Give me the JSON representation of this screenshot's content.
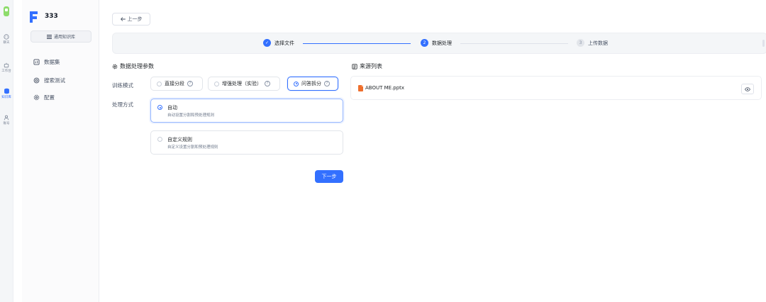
{
  "rail": {
    "items": [
      {
        "label": "聊天"
      },
      {
        "label": "工作台"
      },
      {
        "label": "知识库"
      },
      {
        "label": "账号"
      }
    ]
  },
  "sidebar": {
    "kb_name": "333",
    "kb_type": "通用知识库",
    "items": [
      {
        "label": "数据集"
      },
      {
        "label": "搜索测试"
      },
      {
        "label": "配置"
      }
    ]
  },
  "header": {
    "back_label": "上一步"
  },
  "steps": [
    {
      "index": "✓",
      "label": "选择文件",
      "status": "done"
    },
    {
      "index": "2",
      "label": "数据处理",
      "status": "active"
    },
    {
      "index": "3",
      "label": "上传数据",
      "status": "pending"
    }
  ],
  "params": {
    "title": "数据处理参数",
    "train_mode_label": "训练模式",
    "train_modes": [
      {
        "label": "直接分段",
        "selected": false
      },
      {
        "label": "增强处理（实验）",
        "selected": false
      },
      {
        "label": "问答拆分",
        "selected": true
      }
    ],
    "method_label": "处理方式",
    "methods": [
      {
        "title": "自动",
        "desc": "自动设置分割和预处理规则",
        "selected": true
      },
      {
        "title": "自定义规则",
        "desc": "自定义设置分割和预处理规则",
        "selected": false
      }
    ],
    "next_label": "下一步"
  },
  "sources": {
    "title": "来源列表",
    "files": [
      {
        "name": "ABOUT ME.pptx"
      }
    ]
  },
  "colors": {
    "accent": "#3370ff",
    "file_icon": "#ee6f2d"
  }
}
